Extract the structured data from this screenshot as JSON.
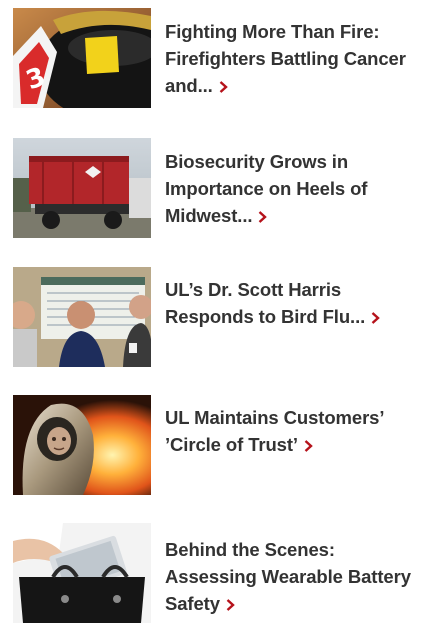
{
  "articles": [
    {
      "title": "Fighting More Than Fire: Firefighters Battling Cancer and...",
      "image": "firefighter-helmet-thumbnail"
    },
    {
      "title": "Biosecurity Grows in Importance on Heels of Midwest...",
      "image": "red-truck-thumbnail"
    },
    {
      "title": "UL’s Dr. Scott Harris Responds to Bird Flu...",
      "image": "people-meeting-thumbnail"
    },
    {
      "title": "UL Maintains Customers’ ’Circle of Trust’",
      "image": "fire-suit-thumbnail"
    },
    {
      "title": "Behind the Scenes: Assessing Wearable Battery Safety",
      "image": "tablet-bag-thumbnail"
    }
  ],
  "accent_color": "#b5121b",
  "chevron_icon": "chevron-right-icon"
}
